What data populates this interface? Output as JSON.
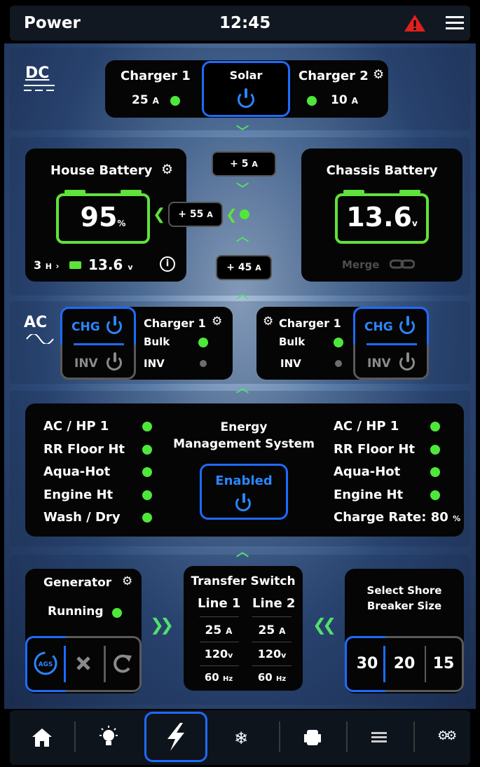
{
  "header": {
    "title": "Power",
    "time": "12:45"
  },
  "dc": {
    "label": "DC",
    "charger1": {
      "label": "Charger 1",
      "current": "25",
      "unit": "A"
    },
    "solar": {
      "label": "Solar"
    },
    "charger2": {
      "label": "Charger 2",
      "current": "10",
      "unit": "A"
    }
  },
  "flows": {
    "top": "+ 5",
    "left": "+ 55",
    "bottom": "+ 45",
    "unit": "A"
  },
  "house_battery": {
    "label": "House Battery",
    "percent": "95",
    "percent_unit": "%",
    "hours": "3",
    "hours_unit": "H",
    "voltage": "13.6",
    "voltage_unit": "v",
    "level": 0.95
  },
  "chassis_battery": {
    "label": "Chassis Battery",
    "voltage": "13.6",
    "voltage_unit": "v",
    "merge_label": "Merge"
  },
  "ac": {
    "label": "AC",
    "left": {
      "chg": "CHG",
      "inv": "INV",
      "name": "Charger 1",
      "mode": "Bulk",
      "inv_label": "INV"
    },
    "right": {
      "chg": "CHG",
      "inv": "INV",
      "name": "Charger 1",
      "mode": "Bulk",
      "inv_label": "INV"
    }
  },
  "ems": {
    "title_line1": "Energy",
    "title_line2": "Management System",
    "button": "Enabled",
    "left_loads": [
      "AC / HP 1",
      "RR Floor Ht",
      "Aqua-Hot",
      "Engine Ht",
      "Wash / Dry"
    ],
    "right_loads": [
      "AC / HP 1",
      "RR Floor Ht",
      "Aqua-Hot",
      "Engine Ht"
    ],
    "charge_rate_label": "Charge Rate:",
    "charge_rate_value": "80",
    "charge_rate_unit": "%"
  },
  "generator": {
    "label": "Generator",
    "status": "Running",
    "ags_label": "AGS"
  },
  "transfer_switch": {
    "title": "Transfer Switch",
    "line1": "Line 1",
    "line2": "Line 2",
    "amps1": "25",
    "amps2": "25",
    "amps_unit": "A",
    "volts1": "120",
    "volts2": "120",
    "volts_unit": "v",
    "hz1": "60",
    "hz2": "60",
    "hz_unit": "Hz"
  },
  "shore": {
    "title_line1": "Select Shore",
    "title_line2": "Breaker Size",
    "sizes": [
      "30",
      "20",
      "15"
    ]
  },
  "colors": {
    "accent_blue": "#1e6bff",
    "status_green": "#4ee83a",
    "warning_red": "#e02020"
  },
  "nav": [
    "home-icon",
    "lightbulb-icon",
    "lightning-icon",
    "snowflake-icon",
    "seat-icon",
    "list-icon",
    "gears-icon"
  ]
}
